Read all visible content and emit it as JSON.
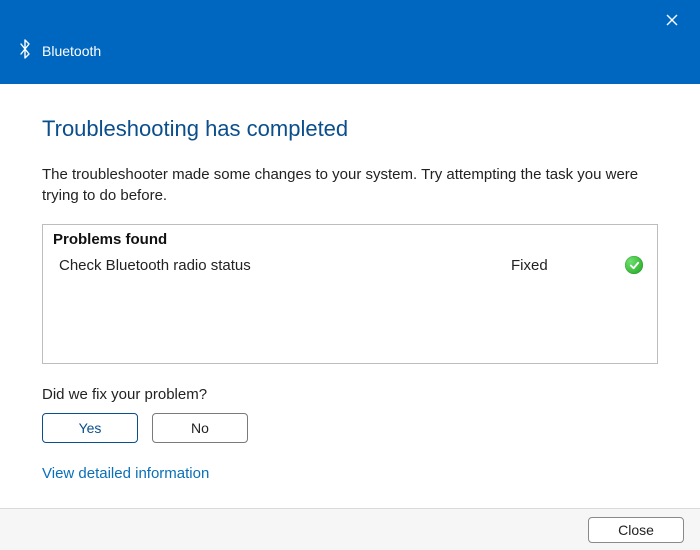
{
  "titlebar": {
    "app_name": "Bluetooth"
  },
  "heading": "Troubleshooting has completed",
  "description": "The troubleshooter made some changes to your system. Try attempting the task you were trying to do before.",
  "problems": {
    "header": "Problems found",
    "rows": [
      {
        "label": "Check Bluetooth radio status",
        "status": "Fixed"
      }
    ]
  },
  "feedback": {
    "question": "Did we fix your problem?",
    "yes": "Yes",
    "no": "No"
  },
  "detail_link": "View detailed information",
  "footer": {
    "close": "Close"
  }
}
